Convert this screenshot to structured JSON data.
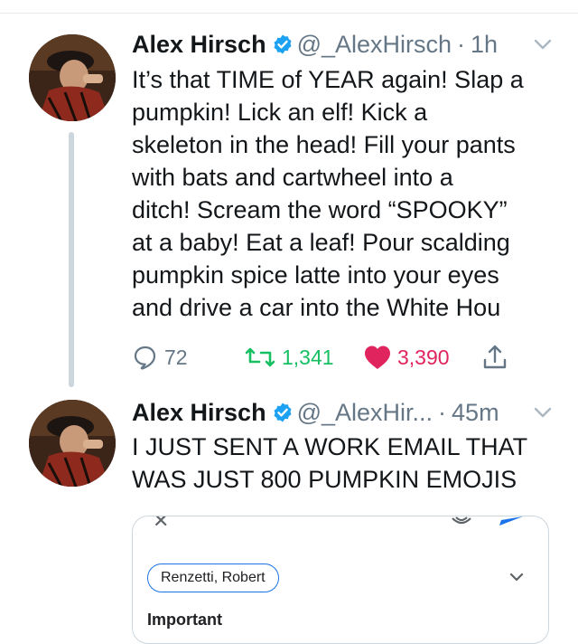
{
  "tweets": [
    {
      "name": "Alex Hirsch",
      "handle": "@_AlexHirsch",
      "dot": "·",
      "time": "1h",
      "lines": [
        "It’s that TIME of YEAR again! Slap a",
        "pumpkin! Lick an elf! Kick a",
        "skeleton in the head! Fill your pants",
        "with bats and cartwheel into a",
        "ditch! Scream the word “SPOOKY”",
        "at a baby! Eat a leaf! Pour scalding",
        "pumpkin spice latte into your eyes",
        "and drive a car into the White Hou"
      ],
      "actions": {
        "replies": "72",
        "retweets": "1,341",
        "likes": "3,390"
      }
    },
    {
      "name": "Alex Hirsch",
      "handle": "@_AlexHir...",
      "dot": "·",
      "time": "45m",
      "lines": [
        "I JUST SENT A WORK EMAIL THAT",
        "WAS JUST 800 PUMPKIN EMOJIS"
      ],
      "media": {
        "close_glyph": "✕",
        "recipient_chip": "Renzetti, Robert",
        "partial_text": "Important"
      }
    }
  ],
  "colors": {
    "verified": "#1da1f2",
    "retweet": "#17bf63",
    "like": "#e0245e",
    "muted": "#657786"
  },
  "icons": [
    "verified-badge-icon",
    "chevron-down-icon",
    "reply-icon",
    "retweet-icon",
    "heart-icon",
    "share-icon",
    "paperclip-icon",
    "send-icon"
  ]
}
